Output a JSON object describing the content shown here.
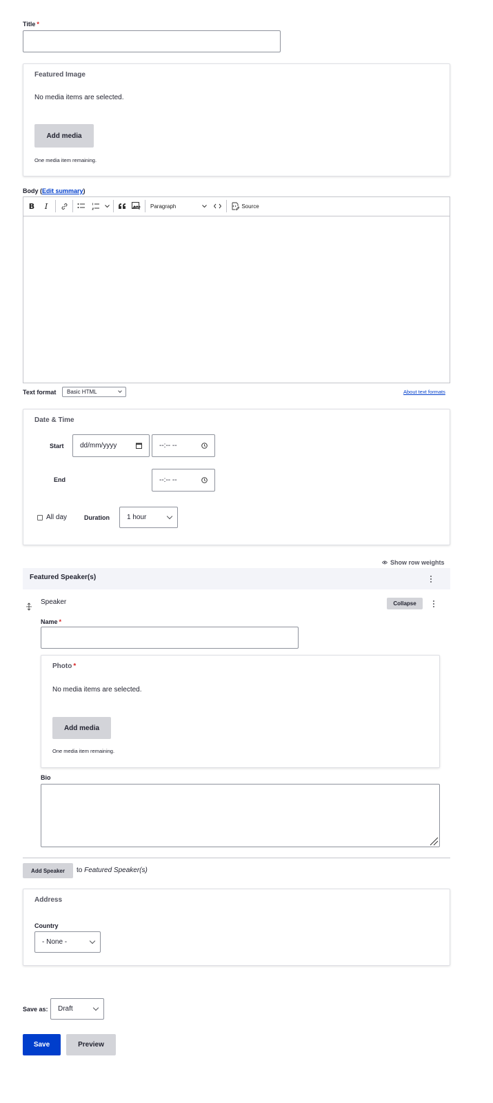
{
  "title_field": {
    "label": "Title",
    "required_mark": "*",
    "value": ""
  },
  "featured_image": {
    "title": "Featured Image",
    "empty_text": "No media items are selected.",
    "add_button": "Add media",
    "remaining": "One media item remaining."
  },
  "body": {
    "label": "Body (",
    "edit_summary": "Edit summary",
    "label_close": ")",
    "toolbar": {
      "bold": "B",
      "italic": "I",
      "paragraph": "Paragraph",
      "source": "Source"
    },
    "text_format_label": "Text format",
    "text_format_value": "Basic HTML",
    "about_formats": "About text formats"
  },
  "date_time": {
    "title": "Date & Time",
    "start_label": "Start",
    "start_date": "dd/mm/yyyy",
    "start_time": "--:-- --",
    "end_label": "End",
    "end_time": "--:-- --",
    "all_day": "All day",
    "duration_label": "Duration",
    "duration_value": "1 hour"
  },
  "speakers": {
    "show_weights": "Show row weights",
    "title": "Featured Speaker(s)",
    "item_label": "Speaker",
    "collapse": "Collapse",
    "name_label": "Name",
    "required_mark": "*",
    "photo_title": "Photo",
    "photo_empty": "No media items are selected.",
    "photo_add": "Add media",
    "photo_remaining": "One media item remaining.",
    "bio_label": "Bio",
    "add_button": "Add Speaker",
    "add_to": "to",
    "add_target": "Featured Speaker(s)"
  },
  "address": {
    "title": "Address",
    "country_label": "Country",
    "country_value": "- None -"
  },
  "footer": {
    "save_as_label": "Save as:",
    "save_as_value": "Draft",
    "save": "Save",
    "preview": "Preview"
  },
  "colors": {
    "primary": "#003ecc",
    "button_gray": "#d3d4d9",
    "required": "#d72222"
  }
}
